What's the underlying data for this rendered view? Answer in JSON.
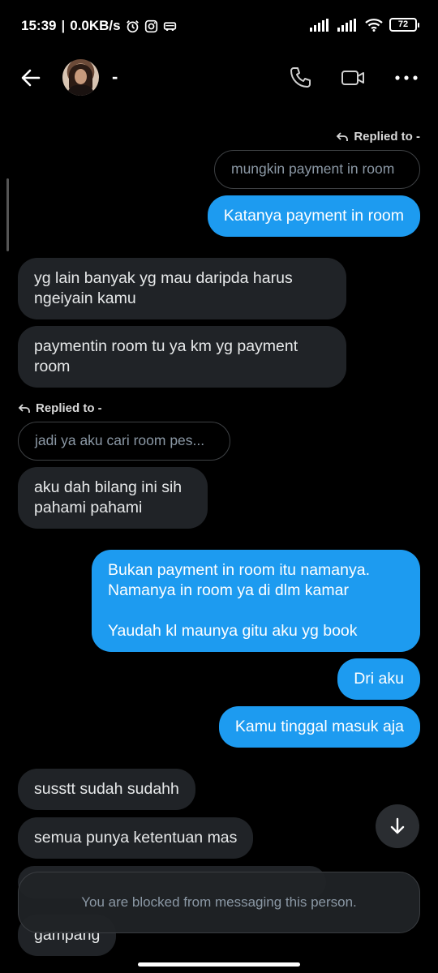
{
  "status_bar": {
    "time": "15:39",
    "network_speed": "0.0KB/s",
    "battery_level": "72",
    "icons": [
      "alarm-icon",
      "instagram-icon",
      "car-icon",
      "signal-icon",
      "signal-icon",
      "wifi-icon",
      "battery-icon"
    ]
  },
  "header": {
    "contact_name": "-",
    "icons": [
      "back-arrow-icon",
      "phone-icon",
      "video-icon",
      "more-icon"
    ]
  },
  "messages": [
    {
      "type": "reply_label",
      "text": "Replied to -",
      "side": "sent"
    },
    {
      "type": "reply_quote",
      "text": "mungkin payment in room",
      "side": "sent"
    },
    {
      "type": "sent",
      "text": "Katanya payment in room"
    },
    {
      "type": "received",
      "text": "yg lain banyak yg mau daripda harus\nngeiyain kamu"
    },
    {
      "type": "received",
      "text": "paymentin room tu ya km yg payment\nroom"
    },
    {
      "type": "reply_label",
      "text": "Replied to -",
      "side": "received"
    },
    {
      "type": "reply_quote",
      "text": "jadi ya aku cari room pes...",
      "side": "received"
    },
    {
      "type": "received",
      "text": "aku dah bilang ini sih\npahami pahami"
    },
    {
      "type": "sent",
      "text": "Bukan payment in room itu namanya.\nNamanya in room ya di dlm kamar\n\nYaudah kl maunya gitu aku yg book"
    },
    {
      "type": "sent",
      "text": "Dri aku"
    },
    {
      "type": "sent",
      "text": "Kamu tinggal masuk aja"
    },
    {
      "type": "received",
      "text": "susstt sudah sudahh"
    },
    {
      "type": "received",
      "text": "semua punya ketentuan mas"
    },
    {
      "type": "received",
      "text": "gampang"
    }
  ],
  "blocked_notice": "You are blocked from messaging this person.",
  "colors": {
    "sent_bubble": "#1d9bf0",
    "received_bubble": "#202327",
    "background": "#000000"
  }
}
